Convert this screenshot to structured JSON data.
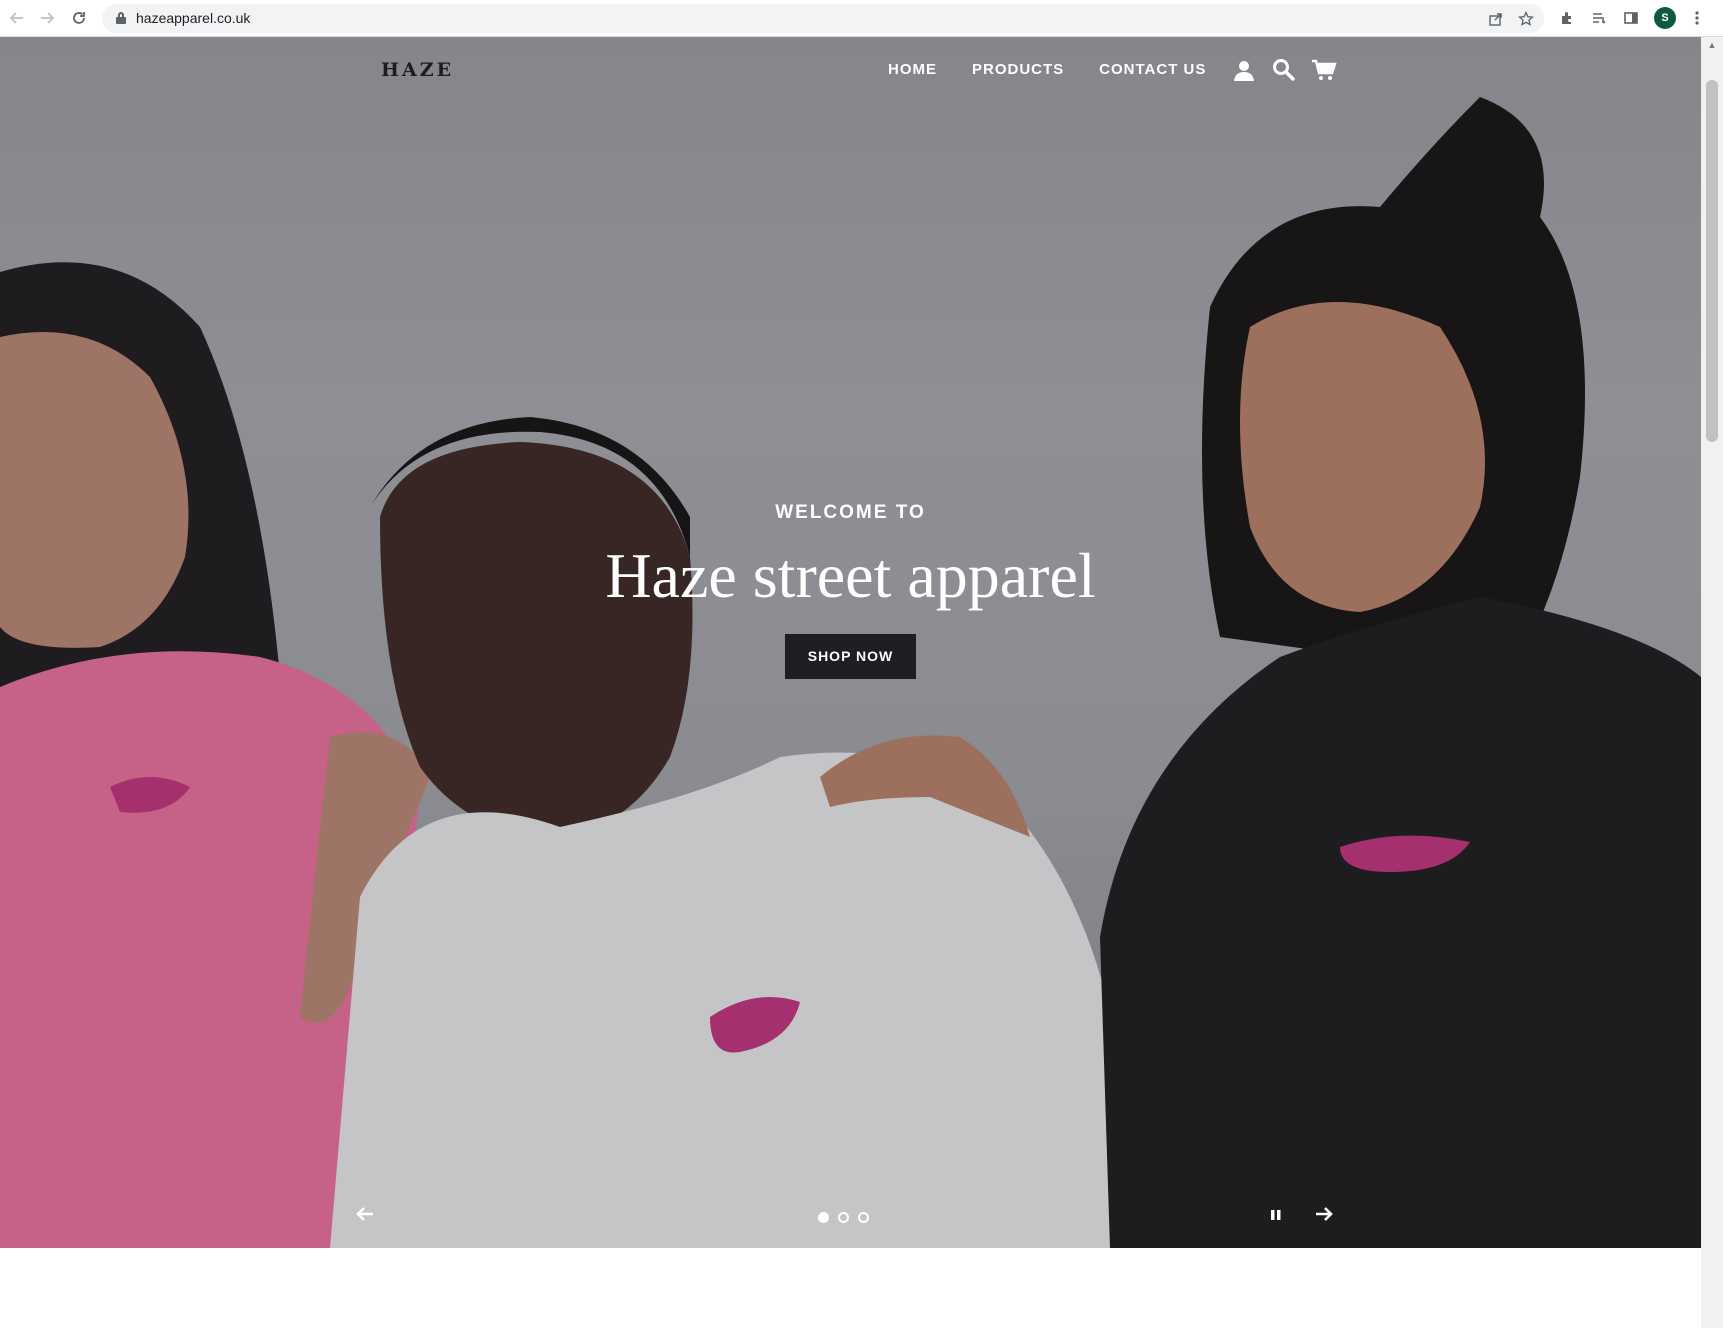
{
  "browser": {
    "url": "hazeapparel.co.uk",
    "profile_initial": "S"
  },
  "header": {
    "logo": "HAZE",
    "nav": [
      {
        "label": "HOME"
      },
      {
        "label": "PRODUCTS"
      },
      {
        "label": "CONTACT US"
      }
    ]
  },
  "hero": {
    "subtitle": "WELCOME TO",
    "title": "Haze street apparel",
    "cta_label": "SHOP NOW",
    "slides_total": 3,
    "active_slide": 1
  },
  "colors": {
    "button_bg": "#1e1f22",
    "profile_avatar": "#0d5a3f",
    "shirt_pink": "#e9709a",
    "logo_print": "#c2327a"
  },
  "icons": [
    "back-arrow-icon",
    "forward-arrow-icon",
    "reload-icon",
    "lock-icon",
    "share-icon",
    "star-icon",
    "extensions-icon",
    "reading-list-icon",
    "side-panel-icon",
    "menu-dots-icon",
    "account-icon",
    "search-icon",
    "cart-icon",
    "arrow-left-icon",
    "arrow-right-icon",
    "pause-icon"
  ]
}
